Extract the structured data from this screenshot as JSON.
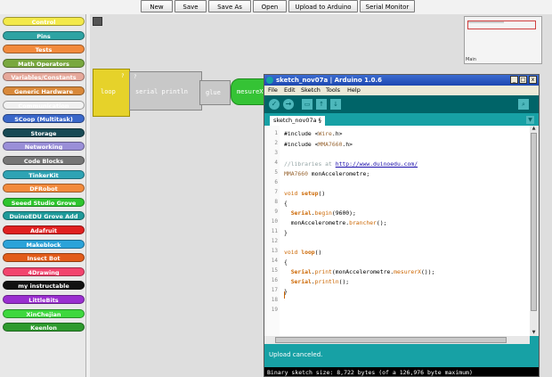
{
  "toolbar": {
    "new_label": "New",
    "save_label": "Save",
    "save_as_label": "Save As",
    "open_label": "Open",
    "upload_label": "Upload to Arduino",
    "serial_label": "Serial Monitor"
  },
  "sidebar": {
    "categories": [
      {
        "label": "Control",
        "color": "#f3e94a"
      },
      {
        "label": "Pins",
        "color": "#2ea3a3"
      },
      {
        "label": "Tests",
        "color": "#f28a3c"
      },
      {
        "label": "Math Operators",
        "color": "#79a83f"
      },
      {
        "label": "Variables/Constants",
        "color": "#e6a89b"
      },
      {
        "label": "Generic Hardware",
        "color": "#d9893a"
      },
      {
        "label": "Communication",
        "color": "#f2f2f2"
      },
      {
        "label": "SCoop (Multitask)",
        "color": "#3a67c9"
      },
      {
        "label": "Storage",
        "color": "#184a55"
      },
      {
        "label": "Networking",
        "color": "#9a8fd8"
      },
      {
        "label": "Code Blocks",
        "color": "#767676"
      },
      {
        "label": "TinkerKit",
        "color": "#2ea3b4"
      },
      {
        "label": "DFRobot",
        "color": "#f28a3c"
      },
      {
        "label": "Seeed Studio Grove",
        "color": "#2ec52e"
      },
      {
        "label": "DuinoEDU Grove Add",
        "color": "#1f9a9a"
      },
      {
        "label": "Adafruit",
        "color": "#e02020"
      },
      {
        "label": "Makeblock",
        "color": "#2ba3d9"
      },
      {
        "label": "Insect Bot",
        "color": "#e25c1a"
      },
      {
        "label": "4Drawing",
        "color": "#f2446e"
      },
      {
        "label": "my instructable",
        "color": "#111111"
      },
      {
        "label": "LittleBits",
        "color": "#9a2fd0"
      },
      {
        "label": "XinChejian",
        "color": "#3ed83e"
      },
      {
        "label": "Keenlon",
        "color": "#2e9a2e"
      }
    ]
  },
  "workspace": {
    "blocks": {
      "loop": "loop",
      "serial_println": "serial println",
      "glue": "glue",
      "mesure": "mesureX",
      "question_mark": "?"
    },
    "minimap_label": "Main"
  },
  "ide": {
    "title": "sketch_nov07a | Arduino 1.0.6",
    "menu": [
      "File",
      "Edit",
      "Sketch",
      "Tools",
      "Help"
    ],
    "tab_label": "sketch_nov07a §",
    "line_numbers": [
      "1",
      "2",
      "3",
      "4",
      "5",
      "6",
      "7",
      "8",
      "9",
      "10",
      "11",
      "12",
      "13",
      "14",
      "15",
      "16",
      "17",
      "18",
      "19"
    ],
    "code": {
      "l1_a": "#include <",
      "l1_b": "Wire",
      "l1_c": ".h>",
      "l2_a": "#include <",
      "l2_b": "MMA7660",
      "l2_c": ".h>",
      "l4_a": "//libraries at ",
      "l4_b": "http://www.duinoedu.com/",
      "l5_a": "MMA7660",
      "l5_b": " monAccelerometre;",
      "l7_a": "void",
      "l7_b": " ",
      "l7_c": "setup",
      "l7_d": "()",
      "l8": "{",
      "l9_a": "  ",
      "l9_b": "Serial",
      "l9_c": ".",
      "l9_d": "begin",
      "l9_e": "(9600);",
      "l10_a": "  monAccelerometre.",
      "l10_b": "brancher",
      "l10_c": "();",
      "l11": "}",
      "l13_a": "void",
      "l13_b": " ",
      "l13_c": "loop",
      "l13_d": "()",
      "l14": "{",
      "l15_a": "  ",
      "l15_b": "Serial",
      "l15_c": ".",
      "l15_d": "print",
      "l15_e": "(monAccelerometre.",
      "l15_f": "mesurerX",
      "l15_g": "());",
      "l16_a": "  ",
      "l16_b": "Serial",
      "l16_c": ".",
      "l16_d": "println",
      "l16_e": "();",
      "l17": "}"
    },
    "status": "Upload canceled.",
    "console": "Binary sketch size: 8,722 bytes (of a 126,976 byte maximum)"
  }
}
